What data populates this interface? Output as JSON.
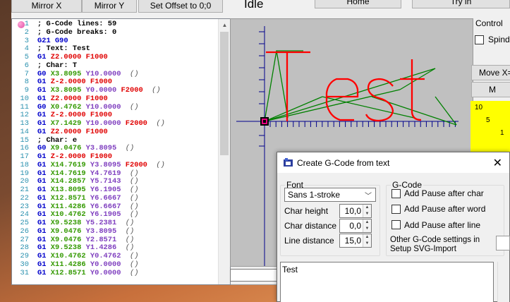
{
  "toolbar": {
    "mirror_x": "Mirror X",
    "mirror_y": "Mirror Y",
    "set_offset": "Set Offset to 0;0",
    "home": "Home",
    "tryin": "Try in"
  },
  "status": "Idle",
  "control": {
    "label": "Control",
    "spindle": "Spindle",
    "move_x": "Move X=",
    "m_button": "M",
    "scale_10": "10",
    "scale_5": "5",
    "scale_1": "1"
  },
  "editor": {
    "lines": [
      {
        "n": "1",
        "parts": [
          [
            "c-comment",
            "; G-Code lines: 59"
          ]
        ]
      },
      {
        "n": "2",
        "parts": [
          [
            "c-comment",
            "; G-Code breaks: 0"
          ]
        ]
      },
      {
        "n": "3",
        "parts": [
          [
            "c-g21",
            "G21 G90"
          ]
        ]
      },
      {
        "n": "4",
        "parts": [
          [
            "c-comment",
            "; Text: Test"
          ]
        ]
      },
      {
        "n": "5",
        "parts": [
          [
            "c-cmd",
            "G1 "
          ],
          [
            "c-z",
            "Z2.0000 "
          ],
          [
            "c-f",
            "F1000"
          ]
        ]
      },
      {
        "n": "6",
        "parts": [
          [
            "c-comment",
            "; Char: T"
          ]
        ]
      },
      {
        "n": "7",
        "parts": [
          [
            "c-cmd",
            "G0 "
          ],
          [
            "c-xy",
            "X3.8095 "
          ],
          [
            "c-y",
            "Y10.0000  "
          ],
          [
            "c-paren",
            "()"
          ]
        ]
      },
      {
        "n": "8",
        "parts": [
          [
            "c-cmd",
            "G1 "
          ],
          [
            "c-z",
            "Z-2.0000 "
          ],
          [
            "c-f",
            "F1000"
          ]
        ]
      },
      {
        "n": "9",
        "parts": [
          [
            "c-cmd",
            "G1 "
          ],
          [
            "c-xy",
            "X3.8095 "
          ],
          [
            "c-y",
            "Y0.0000 "
          ],
          [
            "c-f",
            "F2000  "
          ],
          [
            "c-paren",
            "()"
          ]
        ]
      },
      {
        "n": "10",
        "parts": [
          [
            "c-cmd",
            "G1 "
          ],
          [
            "c-z",
            "Z2.0000 "
          ],
          [
            "c-f",
            "F1000"
          ]
        ]
      },
      {
        "n": "11",
        "parts": [
          [
            "c-cmd",
            "G0 "
          ],
          [
            "c-xy",
            "X0.4762 "
          ],
          [
            "c-y",
            "Y10.0000  "
          ],
          [
            "c-paren",
            "()"
          ]
        ]
      },
      {
        "n": "12",
        "parts": [
          [
            "c-cmd",
            "G1 "
          ],
          [
            "c-z",
            "Z-2.0000 "
          ],
          [
            "c-f",
            "F1000"
          ]
        ]
      },
      {
        "n": "13",
        "parts": [
          [
            "c-cmd",
            "G1 "
          ],
          [
            "c-xy",
            "X7.1429 "
          ],
          [
            "c-y",
            "Y10.0000 "
          ],
          [
            "c-f",
            "F2000  "
          ],
          [
            "c-paren",
            "()"
          ]
        ]
      },
      {
        "n": "14",
        "parts": [
          [
            "c-cmd",
            "G1 "
          ],
          [
            "c-z",
            "Z2.0000 "
          ],
          [
            "c-f",
            "F1000"
          ]
        ]
      },
      {
        "n": "15",
        "parts": [
          [
            "c-comment",
            "; Char: e"
          ]
        ]
      },
      {
        "n": "16",
        "parts": [
          [
            "c-cmd",
            "G0 "
          ],
          [
            "c-xy",
            "X9.0476 "
          ],
          [
            "c-y",
            "Y3.8095  "
          ],
          [
            "c-paren",
            "()"
          ]
        ]
      },
      {
        "n": "17",
        "parts": [
          [
            "c-cmd",
            "G1 "
          ],
          [
            "c-z",
            "Z-2.0000 "
          ],
          [
            "c-f",
            "F1000"
          ]
        ]
      },
      {
        "n": "18",
        "parts": [
          [
            "c-cmd",
            "G1 "
          ],
          [
            "c-xy",
            "X14.7619 "
          ],
          [
            "c-y",
            "Y3.8095 "
          ],
          [
            "c-f",
            "F2000  "
          ],
          [
            "c-paren",
            "()"
          ]
        ]
      },
      {
        "n": "19",
        "parts": [
          [
            "c-cmd",
            "G1 "
          ],
          [
            "c-xy",
            "X14.7619 "
          ],
          [
            "c-y",
            "Y4.7619  "
          ],
          [
            "c-paren",
            "()"
          ]
        ]
      },
      {
        "n": "20",
        "parts": [
          [
            "c-cmd",
            "G1 "
          ],
          [
            "c-xy",
            "X14.2857 "
          ],
          [
            "c-y",
            "Y5.7143  "
          ],
          [
            "c-paren",
            "()"
          ]
        ]
      },
      {
        "n": "21",
        "parts": [
          [
            "c-cmd",
            "G1 "
          ],
          [
            "c-xy",
            "X13.8095 "
          ],
          [
            "c-y",
            "Y6.1905  "
          ],
          [
            "c-paren",
            "()"
          ]
        ]
      },
      {
        "n": "22",
        "parts": [
          [
            "c-cmd",
            "G1 "
          ],
          [
            "c-xy",
            "X12.8571 "
          ],
          [
            "c-y",
            "Y6.6667  "
          ],
          [
            "c-paren",
            "()"
          ]
        ]
      },
      {
        "n": "23",
        "parts": [
          [
            "c-cmd",
            "G1 "
          ],
          [
            "c-xy",
            "X11.4286 "
          ],
          [
            "c-y",
            "Y6.6667  "
          ],
          [
            "c-paren",
            "()"
          ]
        ]
      },
      {
        "n": "24",
        "parts": [
          [
            "c-cmd",
            "G1 "
          ],
          [
            "c-xy",
            "X10.4762 "
          ],
          [
            "c-y",
            "Y6.1905  "
          ],
          [
            "c-paren",
            "()"
          ]
        ]
      },
      {
        "n": "25",
        "parts": [
          [
            "c-cmd",
            "G1 "
          ],
          [
            "c-xy",
            "X9.5238 "
          ],
          [
            "c-y",
            "Y5.2381  "
          ],
          [
            "c-paren",
            "()"
          ]
        ]
      },
      {
        "n": "26",
        "parts": [
          [
            "c-cmd",
            "G1 "
          ],
          [
            "c-xy",
            "X9.0476 "
          ],
          [
            "c-y",
            "Y3.8095  "
          ],
          [
            "c-paren",
            "()"
          ]
        ]
      },
      {
        "n": "27",
        "parts": [
          [
            "c-cmd",
            "G1 "
          ],
          [
            "c-xy",
            "X9.0476 "
          ],
          [
            "c-y",
            "Y2.8571  "
          ],
          [
            "c-paren",
            "()"
          ]
        ]
      },
      {
        "n": "28",
        "parts": [
          [
            "c-cmd",
            "G1 "
          ],
          [
            "c-xy",
            "X9.5238 "
          ],
          [
            "c-y",
            "Y1.4286  "
          ],
          [
            "c-paren",
            "()"
          ]
        ]
      },
      {
        "n": "29",
        "parts": [
          [
            "c-cmd",
            "G1 "
          ],
          [
            "c-xy",
            "X10.4762 "
          ],
          [
            "c-y",
            "Y0.4762  "
          ],
          [
            "c-paren",
            "()"
          ]
        ]
      },
      {
        "n": "30",
        "parts": [
          [
            "c-cmd",
            "G1 "
          ],
          [
            "c-xy",
            "X11.4286 "
          ],
          [
            "c-y",
            "Y0.0000  "
          ],
          [
            "c-paren",
            "()"
          ]
        ]
      },
      {
        "n": "31",
        "parts": [
          [
            "c-cmd",
            "G1 "
          ],
          [
            "c-xy",
            "X12.8571 "
          ],
          [
            "c-y",
            "Y0.0000  "
          ],
          [
            "c-paren",
            "()"
          ]
        ]
      }
    ]
  },
  "preview": {
    "path_color": "#ff0000",
    "travel_color": "#008000",
    "origin_color": "#e6007e",
    "axis_color": "#00008b"
  },
  "dialog": {
    "title": "Create G-Code from text",
    "font_group": "Font",
    "font_value": "Sans 1-stroke",
    "char_height_label": "Char height",
    "char_height_value": "10,0",
    "char_distance_label": "Char distance",
    "char_distance_value": "0,0",
    "line_distance_label": "Line distance",
    "line_distance_value": "15,0",
    "gcode_group": "G-Code",
    "pause_char": "Add Pause after char",
    "pause_word": "Add Pause after word",
    "pause_line": "Add Pause after line",
    "other_settings_1": "Other G-Code settings in",
    "other_settings_2": "Setup SVG-Import",
    "text_value": "Test"
  }
}
